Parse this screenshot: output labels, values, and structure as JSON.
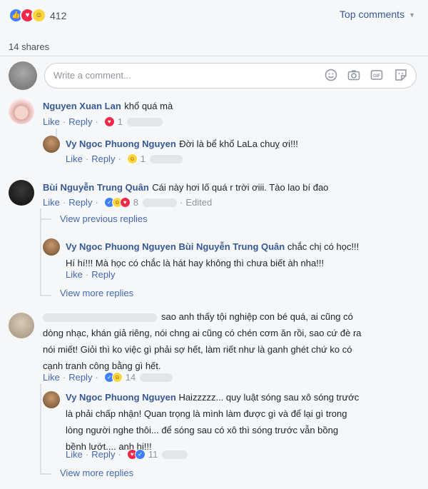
{
  "reactions_bar": {
    "count": "412",
    "sort_label": "Top comments",
    "shares_label": "14 shares"
  },
  "composer": {
    "placeholder": "Write a comment..."
  },
  "labels": {
    "like": "Like",
    "reply": "Reply",
    "edited": "Edited"
  },
  "comments": [
    {
      "author": "Nguyen Xuan Lan",
      "text": "khổ quá mà",
      "reaction_count": "1"
    },
    {
      "author": "Vy Ngoc Phuong Nguyen",
      "text": "Đời là bể khổ LaLa chuỵ ơi!!!",
      "reaction_count": "1"
    },
    {
      "author": "Bùi Nguyễn Trung Quân",
      "text": "Cái này hơi lố quá r trời ơiii. Tào lao bí đao",
      "reaction_count": "8"
    },
    {
      "view_previous": "View previous replies"
    },
    {
      "author": "Vy Ngoc Phuong Nguyen",
      "mention": "Bùi Nguyễn Trung Quân",
      "line1": "chắc chị có học!!!",
      "line2": "Hí hí!!! Mà học có chắc là hát hay không thì chưa biết àh nha!!!"
    },
    {
      "view_more": "View more replies"
    },
    {
      "lines": [
        "sao anh thấy tội nghiệp con bé quá, ai cũng có",
        "dòng nhạc, khán giả riêng, nói chng ai cũng có chén cơm ăn rồi, sao cứ đè ra",
        "nói miết! Giỏi thì ko việc gì phải sợ hết, làm riết như là ganh ghét chứ ko có",
        "cạnh tranh công bằng gì hết."
      ],
      "reaction_count": "14"
    },
    {
      "author": "Vy Ngoc Phuong Nguyen",
      "lines": [
        "Haizzzzz... quy luật sóng sau xô sóng trước",
        "là phải chấp nhận! Quan trọng là mình làm được gì và để lại gì trong",
        "lòng người nghe thôi... để sóng sau có xô thì sóng trước vẫn bồng",
        "bềnh lướt.... anh hi!!!"
      ],
      "reaction_count": "11"
    },
    {
      "view_more": "View more replies"
    }
  ],
  "colors": {
    "link": "#365899",
    "action": "#4267b2",
    "muted": "#90949c",
    "like": "#4080ff",
    "love": "#f0284a",
    "haha": "#fcd53f"
  }
}
